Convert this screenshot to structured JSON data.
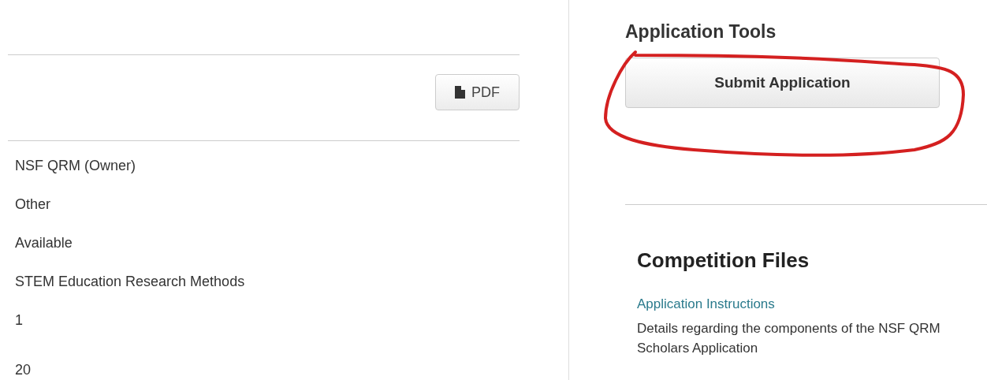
{
  "details": {
    "pdf_button": "PDF",
    "values": [
      "NSF QRM (Owner)",
      "Other",
      "Available",
      "STEM Education Research Methods",
      "1",
      "20"
    ]
  },
  "application_tools": {
    "title": "Application Tools",
    "submit_button": "Submit Application"
  },
  "competition_files": {
    "title": "Competition Files",
    "files": [
      {
        "link": "Application Instructions",
        "description": "Details regarding the components of the NSF QRM Scholars Application"
      }
    ]
  }
}
